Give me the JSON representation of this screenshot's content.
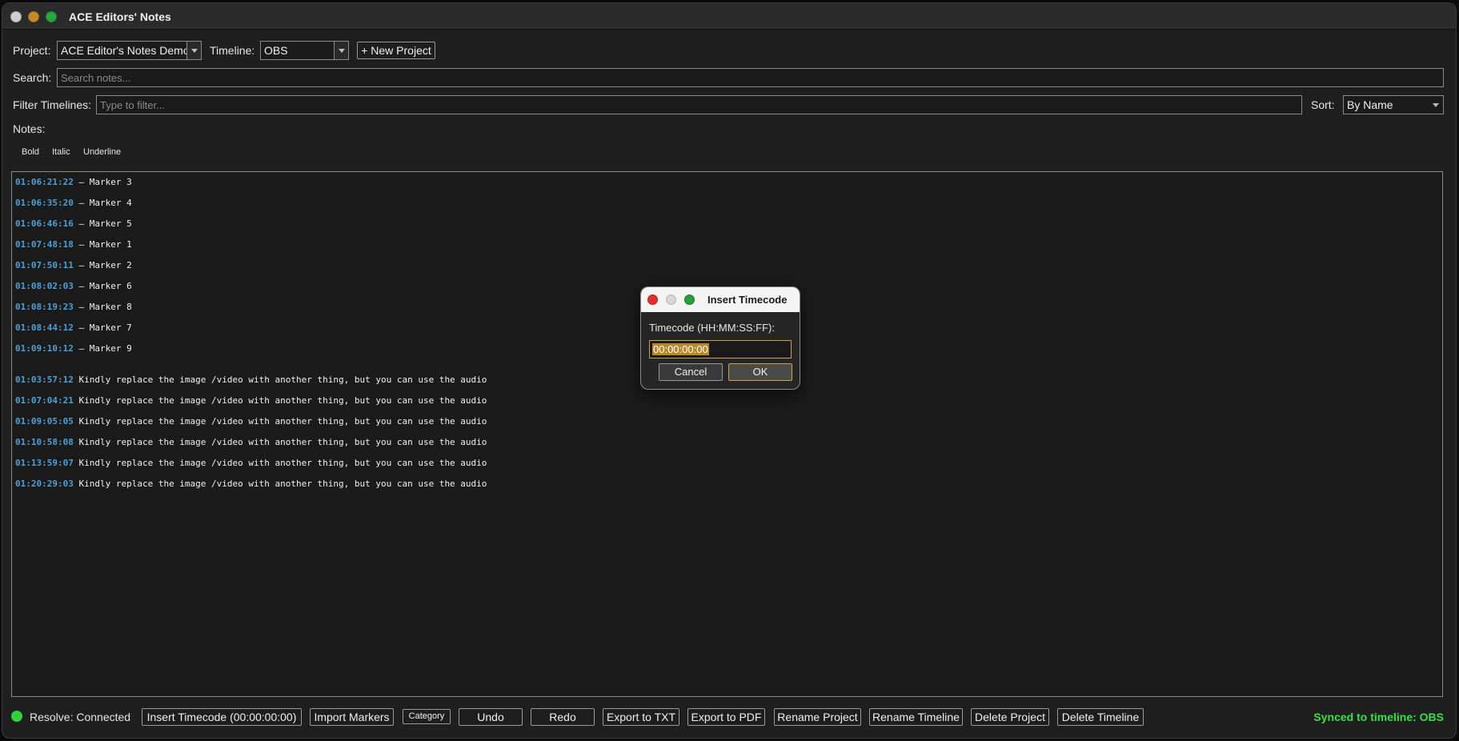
{
  "window": {
    "title": "ACE Editors' Notes"
  },
  "toolbar": {
    "project_label": "Project:",
    "project_value": "ACE Editor's Notes Demo",
    "timeline_label": "Timeline:",
    "timeline_value": "OBS",
    "new_project_button": "+ New Project"
  },
  "search": {
    "label": "Search:",
    "placeholder": "Search notes..."
  },
  "filter": {
    "label": "Filter Timelines:",
    "placeholder": "Type to filter...",
    "sort_label": "Sort:",
    "sort_value": "By Name"
  },
  "notes": {
    "label": "Notes:",
    "format_buttons": [
      "Bold",
      "Italic",
      "Underline"
    ],
    "markers": [
      {
        "tc": "01:06:21:22",
        "text": " – Marker 3"
      },
      {
        "tc": "01:06:35:20",
        "text": " – Marker 4"
      },
      {
        "tc": "01:06:46:16",
        "text": " – Marker 5"
      },
      {
        "tc": "01:07:48:18",
        "text": " – Marker 1"
      },
      {
        "tc": "01:07:50:11",
        "text": " – Marker 2"
      },
      {
        "tc": "01:08:02:03",
        "text": " – Marker 6"
      },
      {
        "tc": "01:08:19:23",
        "text": " – Marker 8"
      },
      {
        "tc": "01:08:44:12",
        "text": " – Marker 7"
      },
      {
        "tc": "01:09:10:12",
        "text": " – Marker 9"
      }
    ],
    "comments": [
      {
        "tc": "01:03:57:12",
        "text": " Kindly replace the image /video with another thing, but you can use the audio"
      },
      {
        "tc": "01:07:04:21",
        "text": " Kindly replace the image /video with another thing, but you can use the audio"
      },
      {
        "tc": "01:09:05:05",
        "text": " Kindly replace the image /video with another thing, but you can use the audio"
      },
      {
        "tc": "01:10:58:08",
        "text": " Kindly replace the image /video with another thing, but you can use the audio"
      },
      {
        "tc": "01:13:59:07",
        "text": " Kindly replace the image /video with another thing, but you can use the audio"
      },
      {
        "tc": "01:20:29:03",
        "text": " Kindly replace the image /video with another thing, but you can use the audio"
      }
    ]
  },
  "statusbar": {
    "resolve_status": "Resolve: Connected",
    "insert_timecode": "Insert Timecode (00:00:00:00)",
    "import_markers": "Import Markers",
    "category": "Category",
    "undo": "Undo",
    "redo": "Redo",
    "export_txt": "Export to TXT",
    "export_pdf": "Export to PDF",
    "rename_project": "Rename Project",
    "rename_timeline": "Rename Timeline",
    "delete_project": "Delete Project",
    "delete_timeline": "Delete Timeline",
    "synced": "Synced to timeline: OBS",
    "status_color": "#33d13a"
  },
  "dialog": {
    "title": "Insert Timecode",
    "label": "Timecode (HH:MM:SS:FF):",
    "value": "00:00:00:00",
    "cancel": "Cancel",
    "ok": "OK"
  }
}
